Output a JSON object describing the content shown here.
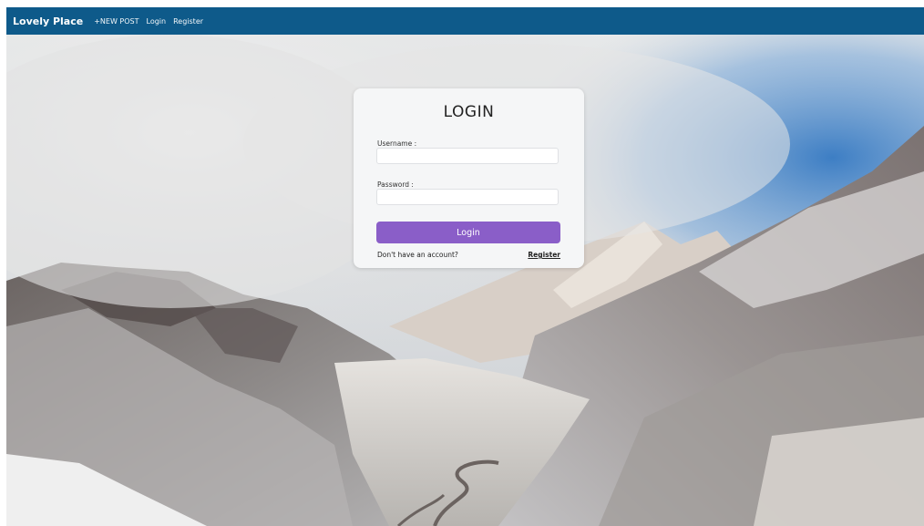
{
  "navbar": {
    "brand": "Lovely Place",
    "links": [
      "+NEW POST",
      "Login",
      "Register"
    ],
    "background": "#0e5a8a"
  },
  "login_form": {
    "title": "LOGIN",
    "username_label": "Username :",
    "username_value": "",
    "password_label": "Password :",
    "password_value": "",
    "submit_label": "Login",
    "submit_color": "#8a5ec8",
    "account_prompt": "Don't have an account?",
    "register_link": "Register"
  },
  "background_image": "snowy-mountain-valley"
}
